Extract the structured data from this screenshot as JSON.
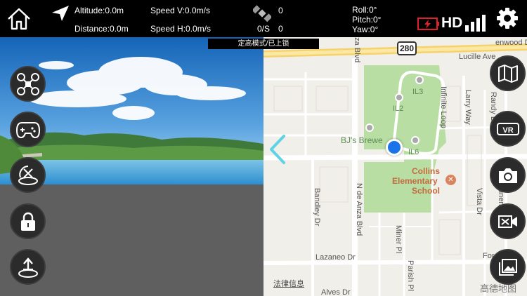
{
  "telemetry": {
    "altitude": "Altitude:0.0m",
    "distance": "Distance:0.0m",
    "speed_v": "Speed V:0.0m/s",
    "speed_h": "Speed H:0.0m/s",
    "satellites": "0",
    "os_label": "0/S",
    "os_value": "0",
    "roll": "Roll:0°",
    "pitch": "Pitch:0°",
    "yaw": "Yaw:0°"
  },
  "mode_banner": "定高模式/已上锁",
  "hd_label": "HD",
  "colors": {
    "battery_warning": "#e0212b",
    "map_park": "#b9dea4",
    "location_dot": "#1a73e8",
    "arrow": "#5fd3e6"
  },
  "left_buttons": [
    "drone-icon",
    "gamepad-icon",
    "calibrate-icon",
    "lock-icon",
    "takeoff-icon"
  ],
  "right_buttons": [
    "map-icon",
    "vr-icon",
    "camera-icon",
    "video-icon",
    "gallery-icon"
  ],
  "map": {
    "highway_shield": "280",
    "streets": {
      "lucille": "Lucille Ave",
      "larry": "Larry Way",
      "randy": "Randy L",
      "infinite": "Infinite Loop",
      "bandley": "Bandley Dr",
      "de_anza": "N de Anza Blvd",
      "de_anza_top": "nza Blvd",
      "miner": "Miner Pl",
      "parish": "Parish Pl",
      "vista": "Vista Dr",
      "pruneridge": "Pruneridge",
      "lazaneo": "Lazaneo Dr",
      "forest": "Forest Ave",
      "alves": "Alves Dr",
      "greenwood": "enwood Dr"
    },
    "pois": {
      "il3": "IL3",
      "il2": "IL2",
      "il6": "IL6",
      "bjs": "BJ's Brewe",
      "school_line1": "Collins",
      "school_line2": "Elementary",
      "school_line3": "School"
    },
    "legal": "法律信息",
    "provider": "高德地图"
  }
}
